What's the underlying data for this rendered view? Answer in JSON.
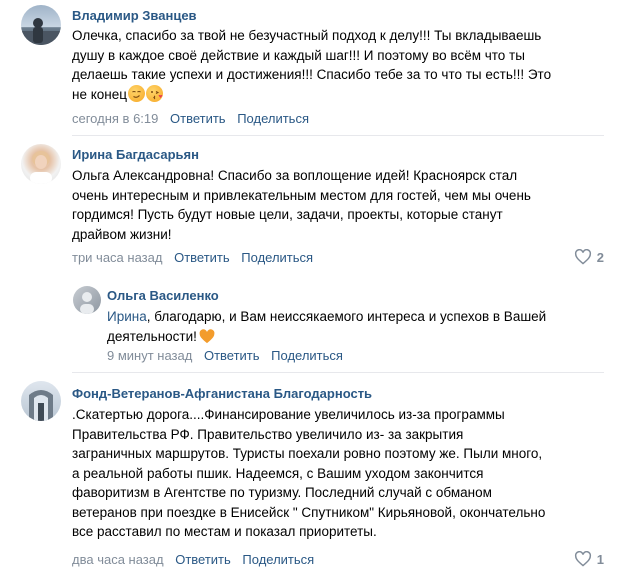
{
  "comments": [
    {
      "author": "Владимир Званцев",
      "lines": [
        "Олечка, спасибо за твой не безучастный подход к делу!!! Ты вкладываешь",
        "душу в каждое своё действие и каждый шаг!!! И поэтому во всём что ты",
        "делаешь такие успехи и достижения!!! Спасибо тебе за то что ты есть!!! Это",
        "не конец"
      ],
      "time": "сегодня в 6:19",
      "reply": "Ответить",
      "share": "Поделиться"
    },
    {
      "author": "Ирина Багдасарьян",
      "lines": [
        "Ольга Александровна! Спасибо за воплощение идей! Красноярск стал",
        "очень интересным и привлекательным местом для гостей, чем мы очень",
        "гордимся! Пусть будут новые цели, задачи, проекты, которые станут",
        "драйвом жизни!"
      ],
      "time": "три часа назад",
      "reply": "Ответить",
      "share": "Поделиться",
      "likes": "2"
    },
    {
      "author": "Ольга Василенко",
      "lines": [
        "Ирина, благодарю, и Вам неиссякаемого интереса и успехов в Вашей",
        "деятельности!"
      ],
      "time": "9 минут назад",
      "reply": "Ответить",
      "share": "Поделиться"
    },
    {
      "author": "Фонд-Ветеранов-Афганистана Благодарность",
      "lines": [
        ".Скатертью дорога....Финансирование увеличилось из-за программы",
        "Правительства РФ. Правительство увеличило из- за закрытия",
        "заграничных маршрутов. Туристы поехали ровно поэтому же. Пыли много,",
        "а реальной работы пшик. Надеемся, с Вашим уходом закончится",
        "фаворитизм в Агентстве по туризму. Последний случай с обманом",
        "ветеранов при поездке в Енисейск \" Спутником\" Кирьяновой, окончательно",
        "все расставил по местам и показал приоритеты."
      ],
      "time": "два часа назад",
      "reply": "Ответить",
      "share": "Поделиться",
      "likes": "1"
    }
  ]
}
